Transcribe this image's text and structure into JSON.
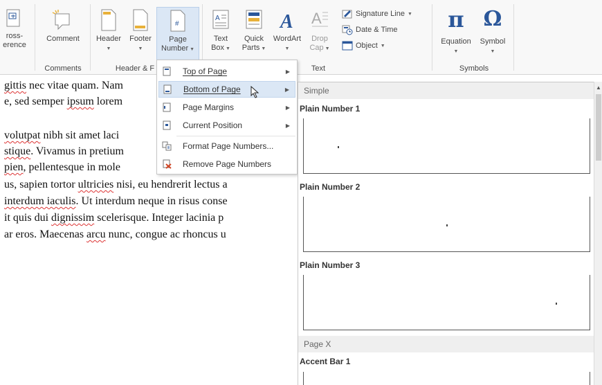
{
  "ribbon": {
    "cross_reference": {
      "line1": "ross-",
      "line2": "erence"
    },
    "comment": {
      "label": "Comment"
    },
    "header": {
      "label": "Header"
    },
    "footer": {
      "label": "Footer"
    },
    "page_number": {
      "line1": "Page",
      "line2": "Number"
    },
    "text_box": {
      "line1": "Text",
      "line2": "Box"
    },
    "quick_parts": {
      "line1": "Quick",
      "line2": "Parts"
    },
    "wordart": {
      "label": "WordArt"
    },
    "drop_cap": {
      "line1": "Drop",
      "line2": "Cap"
    },
    "signature_line": "Signature Line",
    "date_time": "Date & Time",
    "object": "Object",
    "equation": {
      "label": "Equation",
      "glyph": "π"
    },
    "symbol": {
      "label": "Symbol",
      "glyph": "Ω"
    },
    "groups": {
      "comments": "Comments",
      "header_footer": "Header & F",
      "text": "Text",
      "symbols": "Symbols"
    }
  },
  "document": {
    "lines": [
      {
        "pre": "",
        "w1": "gittis",
        "mid": " nec vitae quam. Nam"
      },
      {
        "pre": "e, sed semper ",
        "w1": "ipsum",
        "mid": " lorem"
      },
      {
        "pre": "",
        "w1": "volutpat",
        "mid": " nibh sit amet laci"
      },
      {
        "pre": "",
        "w1": "stique",
        "mid": ". Vivamus in pretium"
      },
      {
        "pre": "",
        "w1": "pien",
        "mid": ", pellentesque in mole"
      },
      {
        "pre": "us, sapien tortor ",
        "w1": "ultricies",
        "mid": " nisi, eu hendrerit lectus a"
      },
      {
        "pre": "",
        "w1": "interdum iaculis",
        "mid": ". Ut interdum neque in risus conse"
      },
      {
        "pre": "it quis dui ",
        "w1": "dignissim",
        "mid": " scelerisque. Integer lacinia p"
      },
      {
        "pre": "ar eros. Maecenas ",
        "w1": "arcu",
        "mid": " nunc, congue ac rhoncus u"
      }
    ]
  },
  "menu": {
    "items": [
      {
        "label": "Top of Page",
        "accel": "T"
      },
      {
        "label": "Bottom of Page",
        "accel": "B"
      },
      {
        "label": "Page Margins",
        "accel": "P"
      },
      {
        "label": "Current Position",
        "accel": "C"
      },
      {
        "label": "Format Page Numbers...",
        "accel": "F"
      },
      {
        "label": "Remove Page Numbers",
        "accel": "R"
      }
    ]
  },
  "gallery": {
    "section_simple": "Simple",
    "plain1": "Plain Number 1",
    "plain2": "Plain Number 2",
    "plain3": "Plain Number 3",
    "section_pagex": "Page X",
    "accent1": "Accent Bar 1"
  },
  "colors": {
    "accent_blue": "#2b579a",
    "highlight": "#dbe7f5",
    "spellcheck": "#d33"
  }
}
